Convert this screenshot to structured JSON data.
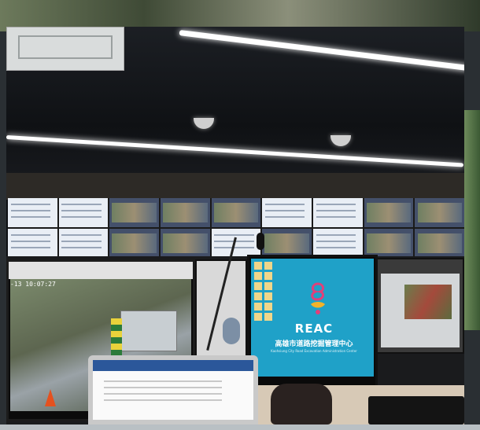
{
  "photo": {
    "subject": "",
    "left_monitor": {
      "timestamp": "-13  10:07:27"
    },
    "main_monitor": {
      "brand": "REAC",
      "chinese_name": "高雄市道路挖掘管理中心",
      "english_name": "Kaohsiung City Road Excavation Administration Center"
    }
  }
}
